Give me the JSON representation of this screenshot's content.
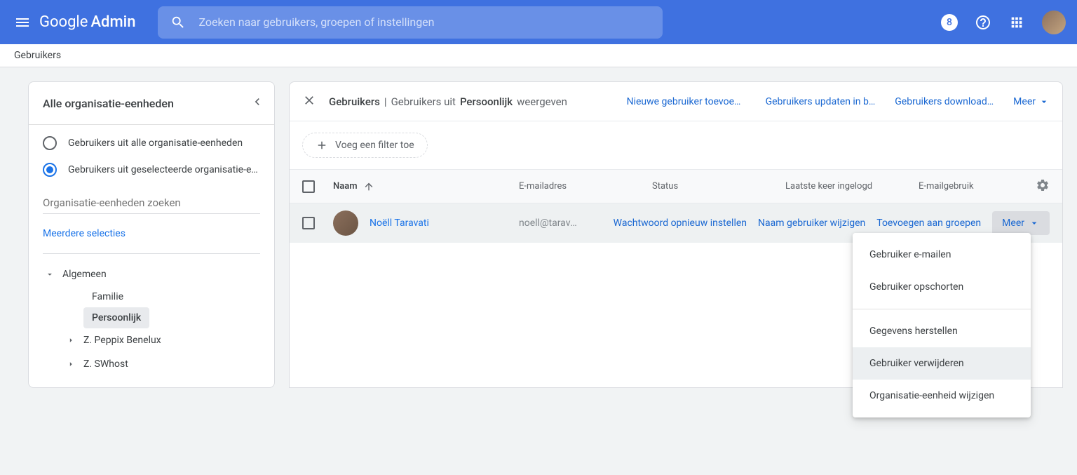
{
  "header": {
    "logo_google": "Google",
    "logo_admin": "Admin",
    "search_placeholder": "Zoeken naar gebruikers, groepen of instellingen",
    "badge": "8"
  },
  "breadcrumb": "Gebruikers",
  "sidebar": {
    "title": "Alle organisatie-eenheden",
    "radio_all": "Gebruikers uit alle organisatie-eenheden",
    "radio_selected": "Gebruikers uit geselecteerde organisatie-eenh…",
    "search_placeholder": "Organisatie-eenheden zoeken",
    "multi_select": "Meerdere selecties",
    "tree": {
      "root": "Algemeen",
      "items": [
        "Familie",
        "Persoonlijk",
        "Z. Peppix Benelux",
        "Z. SWhost"
      ]
    }
  },
  "content": {
    "title_main": "Gebruikers",
    "title_sep": "|",
    "title_pre": "Gebruikers uit",
    "title_org": "Persoonlijk",
    "title_post": "weergeven",
    "actions": {
      "new_user": "Nieuwe gebruiker toevoeg…",
      "bulk_update": "Gebruikers updaten in b…",
      "download": "Gebruikers download…",
      "more": "Meer"
    },
    "filter_add": "Voeg een filter toe",
    "columns": {
      "name": "Naam",
      "email": "E-mailadres",
      "status": "Status",
      "last_login": "Laatste keer ingelogd",
      "email_usage": "E-mailgebruik"
    },
    "row": {
      "name": "Noëll Taravati",
      "email": "noell@taravati",
      "actions": {
        "reset_pw": "Wachtwoord opnieuw instellen",
        "rename": "Naam gebruiker wijzigen",
        "add_groups": "Toevoegen aan groepen",
        "more": "Meer"
      }
    }
  },
  "dropdown": {
    "email_user": "Gebruiker e-mailen",
    "suspend": "Gebruiker opschorten",
    "restore": "Gegevens herstellen",
    "delete": "Gebruiker verwijderen",
    "change_org": "Organisatie-eenheid wijzigen"
  }
}
